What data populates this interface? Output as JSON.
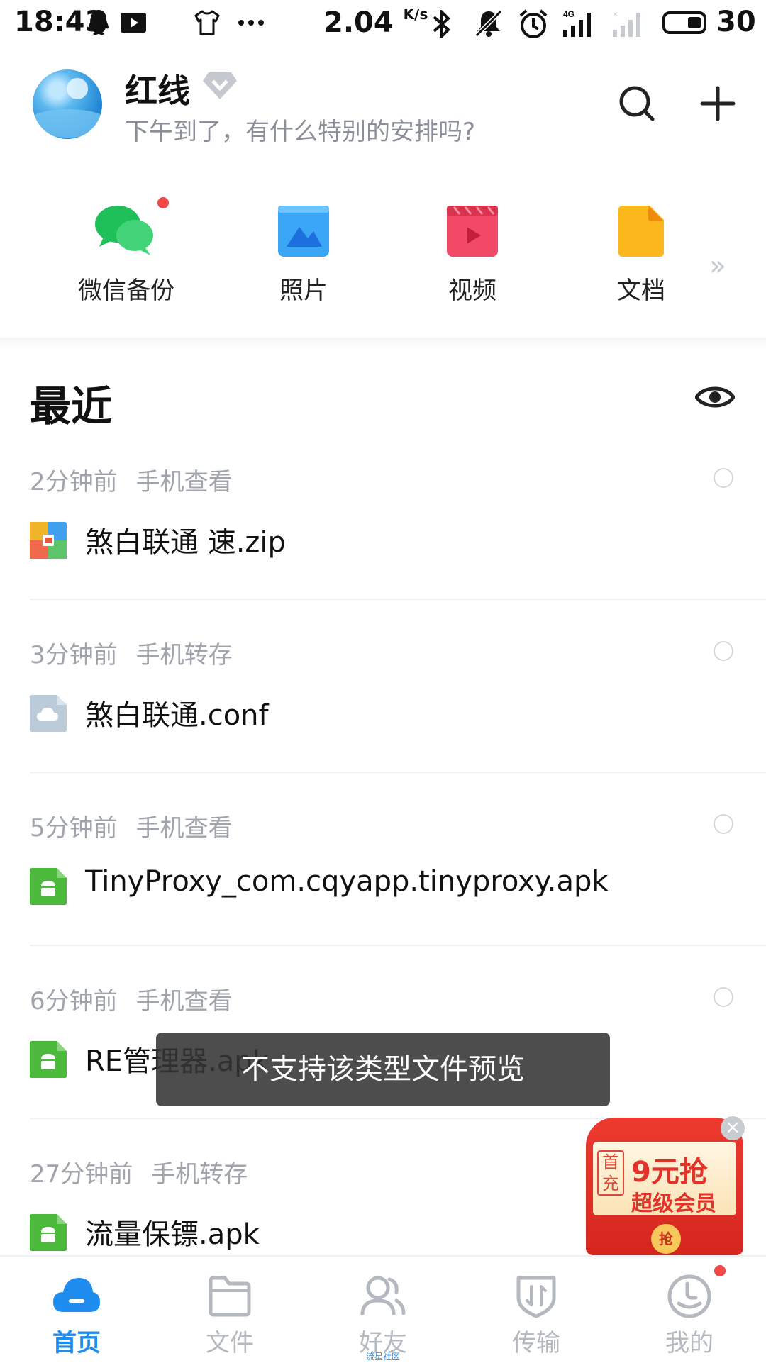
{
  "status_bar": {
    "time": "18:43",
    "speed": "2.04",
    "speed_unit": "K/s",
    "battery": "30"
  },
  "header": {
    "username": "红线",
    "greeting": "下午到了，有什么特别的安排吗?",
    "search_icon": "search-icon",
    "add_icon": "plus-icon"
  },
  "categories": [
    {
      "label": "微信备份",
      "icon": "wechat-icon",
      "color": "#20c15c"
    },
    {
      "label": "照片",
      "icon": "photo-icon",
      "color": "#3a9bf0"
    },
    {
      "label": "视频",
      "icon": "video-icon",
      "color": "#f24a66"
    },
    {
      "label": "文档",
      "icon": "document-icon",
      "color": "#fbb71c"
    }
  ],
  "recent": {
    "title": "最近",
    "items": [
      {
        "time": "2分钟前",
        "action": "手机查看",
        "name": "煞白联通 速.zip",
        "type": "zip"
      },
      {
        "time": "3分钟前",
        "action": "手机转存",
        "name": "煞白联通.conf",
        "type": "conf"
      },
      {
        "time": "5分钟前",
        "action": "手机查看",
        "name": "TinyProxy_com.cqyapp.tinyproxy.apk",
        "type": "apk"
      },
      {
        "time": "6分钟前",
        "action": "手机查看",
        "name": "RE管理器.apk",
        "type": "apk"
      },
      {
        "time": "27分钟前",
        "action": "手机转存",
        "name": "流量保镖.apk",
        "type": "apk"
      }
    ]
  },
  "toast": {
    "text": "不支持该类型文件预览"
  },
  "promo": {
    "tag": "首充",
    "headline": "9元抢",
    "subline": "超级会员",
    "coin": "抢"
  },
  "bottom_nav": {
    "tabs": [
      {
        "label": "首页",
        "active": true
      },
      {
        "label": "文件",
        "active": false
      },
      {
        "label": "好友",
        "active": false,
        "sub": "流星社区"
      },
      {
        "label": "传输",
        "active": false
      },
      {
        "label": "我的",
        "active": false
      }
    ]
  },
  "colors": {
    "accent": "#1f8cf0",
    "badge": "#f04848"
  }
}
